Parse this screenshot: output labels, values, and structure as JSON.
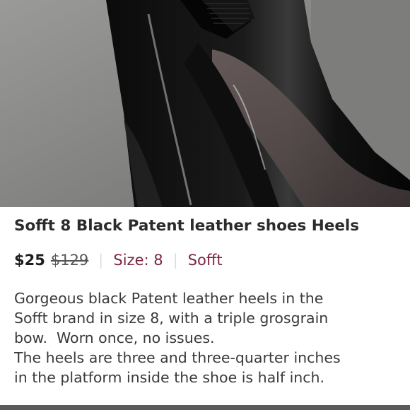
{
  "listing": {
    "title": "Sofft 8 Black Patent leather shoes Heels",
    "price": "$25",
    "original_price": "$129",
    "separator": "|",
    "size_label": "Size: 8",
    "brand": "Sofft",
    "description_lines": [
      "Gorgeous black Patent leather heels in the",
      "Sofft brand in size 8, with a triple grosgrain",
      "bow.  Worn once, no issues.",
      "The heels are three and three-quarter inches",
      "in the platform inside the shoe is half inch."
    ]
  },
  "colors": {
    "accent": "#7b2640",
    "title": "#2b2b2b",
    "body_text": "#3a3a3a"
  },
  "image": {
    "subject": "black patent leather heel with grosgrain bow"
  }
}
